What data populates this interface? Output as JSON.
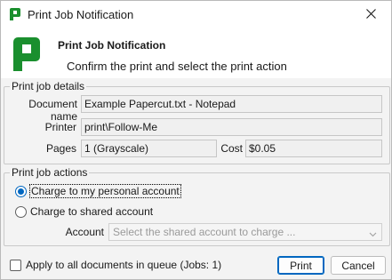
{
  "window": {
    "title": "Print Job Notification",
    "close_icon": "close-icon",
    "app_icon": "papercut-logo-icon"
  },
  "header": {
    "title": "Print Job Notification",
    "subtitle": "Confirm the print and select the print action"
  },
  "details": {
    "legend": "Print job details",
    "document_label": "Document name",
    "document_value": "Example Papercut.txt - Notepad",
    "printer_label": "Printer",
    "printer_value": "print\\Follow-Me",
    "pages_label": "Pages",
    "pages_value": "1   (Grayscale)",
    "cost_label": "Cost",
    "cost_value": "$0.05"
  },
  "actions": {
    "legend": "Print job actions",
    "personal_label": "Charge to my personal account",
    "personal_selected": true,
    "shared_label": "Charge to shared account",
    "shared_selected": false,
    "account_label": "Account",
    "account_placeholder": "Select the shared account to charge ..."
  },
  "footer": {
    "apply_all_label": "Apply to all documents in queue (Jobs: 1)",
    "apply_all_checked": false,
    "print_label": "Print",
    "cancel_label": "Cancel"
  },
  "colors": {
    "brand_green": "#1a8f2e",
    "accent_blue": "#0067c0"
  }
}
